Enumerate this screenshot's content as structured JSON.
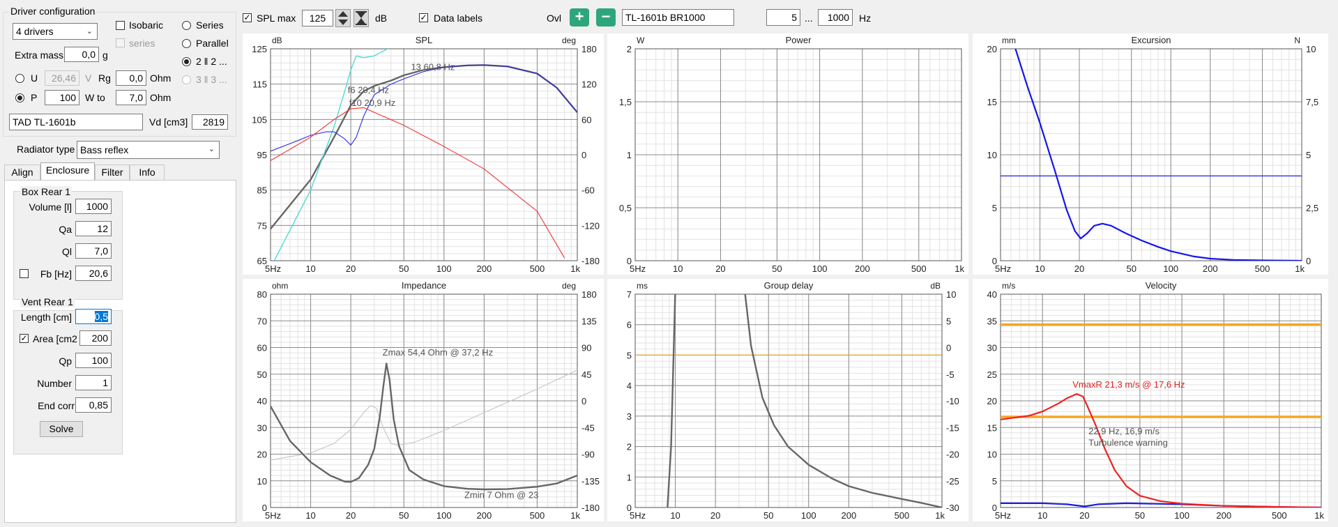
{
  "left": {
    "driver_config_title": "Driver configuration",
    "drivers_combo": "4 drivers",
    "isobaric": "Isobaric",
    "series_sub": "series",
    "series": "Series",
    "parallel": "Parallel",
    "par_opt1": "2 ‖ 2 ...",
    "par_opt2": "3 ‖ 3 ...",
    "extra_mass_label": "Extra mass",
    "extra_mass_value": "0,0",
    "extra_mass_unit": "g",
    "u_label": "U",
    "u_value": "26,46",
    "u_unit": "V",
    "rg_label": "Rg",
    "rg_value": "0,0",
    "rg_unit": "Ohm",
    "p_label": "P",
    "p_value": "100",
    "w_to_label": "W to",
    "w_to_value": "7,0",
    "w_to_unit": "Ohm",
    "driver_name": "TAD TL-1601b",
    "vd_label": "Vd [cm3]",
    "vd_value": "2819",
    "radiator_label": "Radiator type",
    "radiator_value": "Bass reflex",
    "tabs": [
      "Align",
      "Enclosure",
      "Filter",
      "Info"
    ],
    "box_title": "Box Rear 1",
    "volume_label": "Volume [l]",
    "volume_value": "1000",
    "qa_label": "Qa",
    "qa_value": "12",
    "ql_label": "Ql",
    "ql_value": "7,0",
    "fb_label": "Fb [Hz]",
    "fb_value": "20,6",
    "vent_title": "Vent Rear 1",
    "length_label": "Length [cm]",
    "length_value": "0,5",
    "area_label": "Area [cm2",
    "area_value": "200",
    "qp_label": "Qp",
    "qp_value": "100",
    "number_label": "Number",
    "number_value": "1",
    "endcorr_label": "End corr",
    "endcorr_value": "0,85",
    "solve_label": "Solve"
  },
  "toolbar": {
    "spl_max_label": "SPL max",
    "spl_max_value": "125",
    "db_unit": "dB",
    "data_labels": "Data labels",
    "ovl_label": "Ovl",
    "plus": "+",
    "minus": "−",
    "name_value": "TL-1601b BR1000",
    "f_from": "5",
    "dots": "...",
    "f_to": "1000",
    "hz_unit": "Hz"
  },
  "chart_data": [
    {
      "id": "spl",
      "type": "line",
      "title": "SPL",
      "ylabel": "dB",
      "y2label": "deg",
      "ylim": [
        65,
        125
      ],
      "yticks": [
        65,
        75,
        85,
        95,
        105,
        115,
        125
      ],
      "y2lim": [
        -180,
        180
      ],
      "y2ticks": [
        -180,
        -120,
        -60,
        0,
        60,
        120,
        180
      ],
      "xlim": [
        5,
        1000
      ],
      "xticks": [
        "5Hz",
        "10",
        "20",
        "50",
        "100",
        "200",
        "500",
        "1k"
      ],
      "series": [
        {
          "color": "#666666",
          "width": 2.4,
          "axis": "y",
          "points": [
            [
              5,
              74
            ],
            [
              10,
              88
            ],
            [
              15,
              100
            ],
            [
              20,
              109
            ],
            [
              25,
              113
            ],
            [
              30,
              114.5
            ],
            [
              40,
              116
            ],
            [
              50,
              117.5
            ],
            [
              70,
              119
            ],
            [
              100,
              119.8
            ],
            [
              150,
              120.3
            ],
            [
              200,
              120.4
            ],
            [
              300,
              120
            ],
            [
              500,
              118
            ],
            [
              700,
              114
            ],
            [
              1000,
              107
            ]
          ]
        },
        {
          "color": "#44d8d2",
          "width": 1.3,
          "axis": "y",
          "points": [
            [
              5,
              63
            ],
            [
              10,
              85
            ],
            [
              15,
              103
            ],
            [
              18,
              113
            ],
            [
              20,
              119
            ],
            [
              22,
              123
            ],
            [
              25,
              122.5
            ],
            [
              30,
              123
            ],
            [
              40,
              125.5
            ]
          ]
        },
        {
          "color": "#2a2ae0",
          "width": 1.1,
          "axis": "y",
          "points": [
            [
              5,
              96
            ],
            [
              8,
              99
            ],
            [
              10,
              100.5
            ],
            [
              13,
              101.5
            ],
            [
              15,
              101.5
            ],
            [
              18,
              99.5
            ],
            [
              20,
              97.7
            ],
            [
              22,
              100
            ],
            [
              25,
              106
            ],
            [
              30,
              112
            ],
            [
              40,
              115
            ],
            [
              50,
              116.5
            ],
            [
              70,
              118.5
            ],
            [
              100,
              119.8
            ],
            [
              150,
              120.3
            ],
            [
              200,
              120.4
            ],
            [
              300,
              120
            ],
            [
              500,
              118
            ],
            [
              700,
              114
            ],
            [
              1000,
              107
            ]
          ]
        },
        {
          "color": "#f03030",
          "width": 1.1,
          "axis": "y2",
          "points": [
            [
              5,
              -10
            ],
            [
              10,
              30
            ],
            [
              15,
              60
            ],
            [
              20,
              78
            ],
            [
              25,
              80
            ],
            [
              30,
              72
            ],
            [
              50,
              50
            ],
            [
              100,
              14
            ],
            [
              200,
              -24
            ],
            [
              500,
              -96
            ],
            [
              800,
              -175
            ]
          ]
        }
      ],
      "labels": [
        {
          "text": "13 60,8 Hz",
          "x": 60.8,
          "y": 119
        },
        {
          "text": "f6 20,4 Hz",
          "x": 20.4,
          "y": 112.5
        },
        {
          "text": "f10 20,9 Hz",
          "x": 20.9,
          "y": 108.8
        }
      ]
    },
    {
      "id": "power",
      "type": "line",
      "title": "Power",
      "ylabel": "W",
      "ylim": [
        0,
        2
      ],
      "yticks": [
        0,
        0.5,
        1,
        1.5,
        2
      ],
      "ytick_labels": [
        "0",
        "0,5",
        "1",
        "1,5",
        "2"
      ],
      "xlim": [
        5,
        1000
      ],
      "xticks": [
        "5Hz",
        "10",
        "20",
        "50",
        "100",
        "200",
        "500",
        "1k"
      ],
      "series": [],
      "labels": []
    },
    {
      "id": "excursion",
      "type": "line",
      "title": "Excursion",
      "ylabel": "mm",
      "y2label": "N",
      "ylim": [
        0,
        20
      ],
      "yticks": [
        0,
        5,
        10,
        15,
        20
      ],
      "y2lim": [
        0,
        10
      ],
      "y2ticks": [
        0,
        2.5,
        5,
        7.5,
        10
      ],
      "y2tick_labels": [
        "0",
        "2,5",
        "5",
        "7,5",
        "10"
      ],
      "xlim": [
        5,
        1000
      ],
      "xticks": [
        "5Hz",
        "10",
        "20",
        "50",
        "100",
        "200",
        "500",
        "1k"
      ],
      "series": [
        {
          "color": "#2020e0",
          "width": 1.2,
          "axis": "y",
          "points": [
            [
              5,
              8
            ],
            [
              1000,
              8
            ]
          ]
        },
        {
          "color": "#1414f0",
          "width": 2.2,
          "axis": "y",
          "points": [
            [
              6.5,
              20
            ],
            [
              8,
              16.5
            ],
            [
              10,
              13
            ],
            [
              13,
              8.5
            ],
            [
              16,
              4.8
            ],
            [
              18.5,
              2.8
            ],
            [
              20.5,
              2.1
            ],
            [
              23,
              2.6
            ],
            [
              26,
              3.3
            ],
            [
              30,
              3.5
            ],
            [
              35,
              3.3
            ],
            [
              45,
              2.6
            ],
            [
              60,
              1.9
            ],
            [
              80,
              1.3
            ],
            [
              100,
              0.9
            ],
            [
              150,
              0.4
            ],
            [
              200,
              0.2
            ],
            [
              300,
              0.08
            ],
            [
              500,
              0.03
            ],
            [
              1000,
              0
            ]
          ]
        }
      ],
      "labels": []
    },
    {
      "id": "impedance",
      "type": "line",
      "title": "Impedance",
      "ylabel": "ohm",
      "y2label": "deg",
      "ylim": [
        0,
        80
      ],
      "yticks": [
        0,
        10,
        20,
        30,
        40,
        50,
        60,
        70,
        80
      ],
      "y2lim": [
        -180,
        180
      ],
      "y2ticks": [
        -180,
        -135,
        -90,
        -45,
        0,
        45,
        90,
        135,
        180
      ],
      "xlim": [
        5,
        1000
      ],
      "xticks": [
        "5Hz",
        "10",
        "20",
        "50",
        "100",
        "200",
        "500",
        "1k"
      ],
      "series": [
        {
          "color": "#c8c8c8",
          "width": 1.2,
          "axis": "y2",
          "points": [
            [
              5,
              -100
            ],
            [
              10,
              -88
            ],
            [
              15,
              -72
            ],
            [
              20,
              -48
            ],
            [
              25,
              -20
            ],
            [
              28,
              -8
            ],
            [
              31,
              -12
            ],
            [
              35,
              -45
            ],
            [
              40,
              -72
            ],
            [
              45,
              -75
            ],
            [
              60,
              -70
            ],
            [
              100,
              -50
            ],
            [
              200,
              -20
            ],
            [
              500,
              20
            ],
            [
              1000,
              52
            ]
          ]
        },
        {
          "color": "#666666",
          "width": 2.4,
          "axis": "y",
          "points": [
            [
              5,
              38
            ],
            [
              7,
              25
            ],
            [
              10,
              17
            ],
            [
              14,
              12
            ],
            [
              18,
              9.7
            ],
            [
              20,
              9.6
            ],
            [
              23,
              11
            ],
            [
              27,
              16
            ],
            [
              30,
              22
            ],
            [
              33,
              34
            ],
            [
              35,
              45
            ],
            [
              37,
              54
            ],
            [
              39,
              48
            ],
            [
              42,
              33
            ],
            [
              46,
              23
            ],
            [
              55,
              14
            ],
            [
              70,
              10.5
            ],
            [
              100,
              8
            ],
            [
              150,
              7
            ],
            [
              200,
              6.8
            ],
            [
              300,
              6.9
            ],
            [
              500,
              7.8
            ],
            [
              700,
              9
            ],
            [
              1000,
              12
            ]
          ]
        }
      ],
      "labels": [
        {
          "text": "Zmax 54,4 Ohm @ 37,2 Hz",
          "x": 37.2,
          "y": 57
        },
        {
          "text": "Zmin 7 Ohm @ 23",
          "x": 230,
          "y": 3.5
        }
      ]
    },
    {
      "id": "group_delay",
      "type": "line",
      "title": "Group delay",
      "ylabel": "ms",
      "y2label": "dB",
      "ylim": [
        0,
        7
      ],
      "yticks": [
        0,
        1,
        2,
        3,
        4,
        5,
        6,
        7
      ],
      "y2lim": [
        -30,
        10
      ],
      "y2ticks": [
        -30,
        -25,
        -20,
        -15,
        -10,
        -5,
        0,
        5,
        10
      ],
      "xlim": [
        5,
        1000
      ],
      "xticks": [
        "5Hz",
        "10",
        "20",
        "50",
        "100",
        "200",
        "500",
        "1k"
      ],
      "series": [
        {
          "color": "#e8a020",
          "width": 1.2,
          "axis": "y",
          "points": [
            [
              5,
              5
            ],
            [
              1000,
              5
            ]
          ]
        },
        {
          "color": "#666666",
          "width": 2.4,
          "axis": "y",
          "points": [
            [
              8.6,
              -0.5
            ],
            [
              9.3,
              2
            ],
            [
              10,
              7.2
            ]
          ]
        },
        {
          "color": "#666666",
          "width": 2.4,
          "axis": "y",
          "points": [
            [
              33,
              7.2
            ],
            [
              37,
              5.3
            ],
            [
              45,
              3.6
            ],
            [
              55,
              2.7
            ],
            [
              70,
              2
            ],
            [
              100,
              1.4
            ],
            [
              150,
              0.95
            ],
            [
              200,
              0.7
            ],
            [
              300,
              0.48
            ],
            [
              500,
              0.28
            ],
            [
              700,
              0.15
            ],
            [
              1000,
              0
            ]
          ]
        }
      ],
      "labels": []
    },
    {
      "id": "velocity",
      "type": "line",
      "title": "Velocity",
      "ylabel": "m/s",
      "ylim": [
        0,
        40
      ],
      "yticks": [
        0,
        5,
        10,
        15,
        20,
        25,
        30,
        35,
        40
      ],
      "xlim": [
        5,
        1000
      ],
      "xticks": [
        "5Hz",
        "10",
        "20",
        "50",
        "100",
        "200",
        "500",
        "1k"
      ],
      "series": [
        {
          "color": "#f5a623",
          "width": 3.5,
          "axis": "y",
          "points": [
            [
              5,
              34.3
            ],
            [
              1000,
              34.3
            ]
          ]
        },
        {
          "color": "#f5a623",
          "width": 3.5,
          "axis": "y",
          "points": [
            [
              5,
              17
            ],
            [
              1000,
              17
            ]
          ]
        },
        {
          "color": "#1a1ae0",
          "width": 2.2,
          "axis": "y",
          "points": [
            [
              5,
              0.8
            ],
            [
              10,
              0.8
            ],
            [
              15,
              0.6
            ],
            [
              20,
              0.2
            ],
            [
              25,
              0.6
            ],
            [
              40,
              0.8
            ],
            [
              100,
              0.6
            ],
            [
              200,
              0.3
            ],
            [
              500,
              0.1
            ],
            [
              1000,
              0
            ]
          ]
        },
        {
          "color": "#f02020",
          "width": 2.2,
          "axis": "y",
          "points": [
            [
              5,
              16.5
            ],
            [
              8,
              17.2
            ],
            [
              10,
              18
            ],
            [
              13,
              19.5
            ],
            [
              15,
              20.5
            ],
            [
              17.6,
              21.3
            ],
            [
              19.5,
              20.8
            ],
            [
              21,
              19
            ],
            [
              24,
              15.5
            ],
            [
              28,
              11
            ],
            [
              33,
              7
            ],
            [
              40,
              4
            ],
            [
              50,
              2.2
            ],
            [
              70,
              1.2
            ],
            [
              100,
              0.7
            ],
            [
              200,
              0.3
            ],
            [
              500,
              0.1
            ],
            [
              1000,
              0
            ]
          ]
        }
      ],
      "labels": [
        {
          "text": "VmaxR 21,3 m/s @ 17,6 Hz",
          "x": 17.6,
          "y": 22.5,
          "color": "#e02020"
        },
        {
          "text": "22,9 Hz, 16,9 m/s",
          "x": 22.9,
          "y": 13.7
        },
        {
          "text": "Turbulence warning",
          "x": 22.9,
          "y": 11.6
        }
      ]
    }
  ]
}
